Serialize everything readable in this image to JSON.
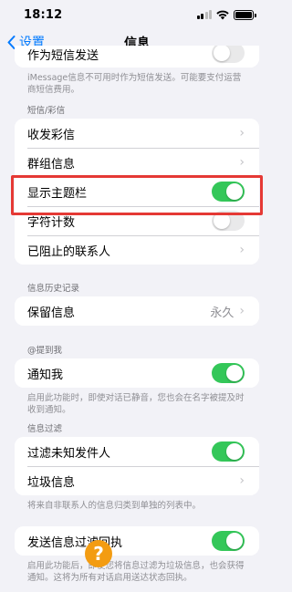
{
  "status_bar": {
    "time": "18:12"
  },
  "nav": {
    "back_label": "设置",
    "title": "信息"
  },
  "top_partial": {
    "row_label": "作为短信发送",
    "toggle_on": false,
    "footer": "iMessage信息不可用时作为短信发送。可能要支付运营商短信费用。"
  },
  "sms_section": {
    "header": "短信/彩信",
    "rows": [
      {
        "label": "收发彩信",
        "type": "chevron"
      },
      {
        "label": "群组信息",
        "type": "chevron"
      },
      {
        "label": "显示主题栏",
        "type": "toggle",
        "on": true
      },
      {
        "label": "字符计数",
        "type": "toggle",
        "on": false
      },
      {
        "label": "已阻止的联系人",
        "type": "chevron"
      }
    ]
  },
  "history_section": {
    "header": "信息历史记录",
    "row_label": "保留信息",
    "row_value": "永久"
  },
  "mention_section": {
    "header": "@提到我",
    "row_label": "通知我",
    "toggle_on": true,
    "footer": "启用此功能时，即使对话已静音，您也会在名字被提及时收到通知。"
  },
  "filter_section": {
    "header": "信息过滤",
    "rows": [
      {
        "label": "过滤未知发件人",
        "type": "toggle",
        "on": true
      },
      {
        "label": "垃圾信息",
        "type": "chevron"
      }
    ],
    "footer": "将来自非联系人的信息归类到单独的列表中。"
  },
  "receipt_section": {
    "row_label": "发送信息过滤回执",
    "toggle_on": true,
    "footer": "启用此功能后，即使您将信息过滤为垃圾信息，也会获得通知。这将为所有对话启用送达状态回执。"
  },
  "colors": {
    "accent": "#007aff",
    "toggle_on": "#34c759",
    "highlight": "#e53935"
  }
}
